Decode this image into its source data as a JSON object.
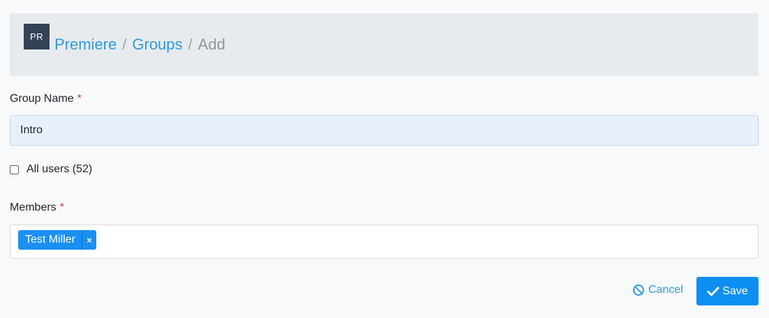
{
  "breadcrumb": {
    "avatar_initials": "PR",
    "items": [
      {
        "label": "Premiere",
        "link": true
      },
      {
        "label": "Groups",
        "link": true
      },
      {
        "label": "Add",
        "link": false
      }
    ],
    "separator": "/"
  },
  "form": {
    "group_name": {
      "label": "Group Name",
      "required_marker": "*",
      "value": "Intro"
    },
    "all_users": {
      "label": "All users (52)",
      "checked": false
    },
    "members": {
      "label": "Members",
      "required_marker": "*",
      "tags": [
        {
          "label": "Test Miller",
          "remove_symbol": "×"
        }
      ]
    }
  },
  "actions": {
    "cancel_label": "Cancel",
    "save_label": "Save"
  },
  "colors": {
    "link": "#2d9cdb",
    "primary": "#0d8ff2",
    "required": "#dc3545",
    "avatar_bg": "#344256",
    "header_bg": "#e8ebee"
  },
  "icons": {
    "cancel": "ban-icon",
    "save": "check-icon"
  }
}
